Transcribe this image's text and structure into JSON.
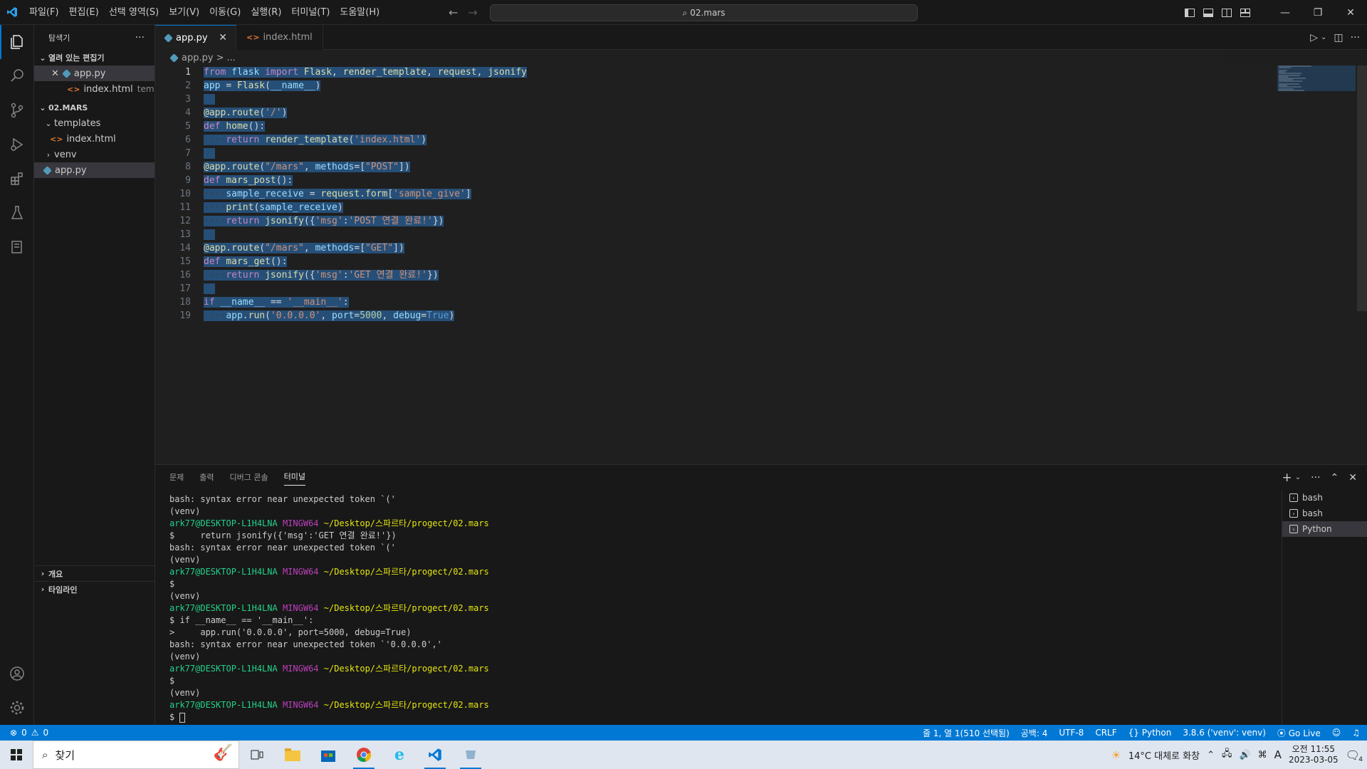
{
  "menu": [
    "파일(F)",
    "편집(E)",
    "선택 영역(S)",
    "보기(V)",
    "이동(G)",
    "실행(R)",
    "터미널(T)",
    "도움말(H)"
  ],
  "command_center": "02.mars",
  "sidebar": {
    "title": "탐색기",
    "more": "···",
    "open_editors": "열려 있는 편집기",
    "open_files": [
      {
        "name": "app.py",
        "desc": ""
      },
      {
        "name": "index.html",
        "desc": "templ..."
      }
    ],
    "project": "02.MARS",
    "tree": [
      {
        "name": "templates",
        "kind": "folder-open"
      },
      {
        "name": "index.html",
        "kind": "html"
      },
      {
        "name": "venv",
        "kind": "folder"
      },
      {
        "name": "app.py",
        "kind": "py"
      }
    ],
    "outline": "개요",
    "timeline": "타임라인"
  },
  "tabs": [
    {
      "label": "app.py",
      "active": true
    },
    {
      "label": "index.html",
      "active": false
    }
  ],
  "breadcrumb": {
    "file": "app.py",
    "sep": ">",
    "rest": "..."
  },
  "code_lines": [
    "from flask import Flask, render_template, request, jsonify",
    "app = Flask(__name__)",
    "",
    "@app.route('/')",
    "def home():",
    "····return render_template('index.html')",
    "",
    "@app.route(\"/mars\", methods=[\"POST\"])",
    "def mars_post():",
    "····sample_receive = request.form['sample_give']",
    "····print(sample_receive)",
    "····return jsonify({'msg':'POST 연결 완료!'})",
    "",
    "@app.route(\"/mars\", methods=[\"GET\"])",
    "def mars_get():",
    "····return jsonify({'msg':'GET 연결 완료!'})",
    "",
    "if __name__ == '__main__':",
    "····app.run('0.0.0.0', port=5000, debug=True)"
  ],
  "panel": {
    "tabs": [
      "문제",
      "출력",
      "디버그 콘솔",
      "터미널"
    ],
    "active_tab": "터미널",
    "terminals": [
      "bash",
      "bash",
      "Python"
    ],
    "lines": [
      {
        "t": "bash: syntax error near unexpected token `('"
      },
      {
        "t": "(venv)"
      },
      {
        "user": "ark77@DESKTOP-L1H4LNA",
        "host": "MINGW64",
        "path": "~/Desktop/스파르타/progect/02.mars"
      },
      {
        "t": "$     return jsonify({'msg':'GET 연결 완료!'})"
      },
      {
        "t": "bash: syntax error near unexpected token `('"
      },
      {
        "t": "(venv)"
      },
      {
        "user": "ark77@DESKTOP-L1H4LNA",
        "host": "MINGW64",
        "path": "~/Desktop/스파르타/progect/02.mars"
      },
      {
        "t": "$"
      },
      {
        "t": "(venv)"
      },
      {
        "user": "ark77@DESKTOP-L1H4LNA",
        "host": "MINGW64",
        "path": "~/Desktop/스파르타/progect/02.mars"
      },
      {
        "t": "$ if __name__ == '__main__':"
      },
      {
        "t": ">     app.run('0.0.0.0', port=5000, debug=True)"
      },
      {
        "t": "bash: syntax error near unexpected token `'0.0.0.0','"
      },
      {
        "t": "(venv)"
      },
      {
        "user": "ark77@DESKTOP-L1H4LNA",
        "host": "MINGW64",
        "path": "~/Desktop/스파르타/progect/02.mars"
      },
      {
        "t": "$"
      },
      {
        "t": "(venv)"
      },
      {
        "user": "ark77@DESKTOP-L1H4LNA",
        "host": "MINGW64",
        "path": "~/Desktop/스파르타/progect/02.mars"
      }
    ],
    "prompt": "$ "
  },
  "status": {
    "errors": "0",
    "warnings": "0",
    "position": "줄 1, 열 1(510 선택됨)",
    "spaces": "공백: 4",
    "encoding": "UTF-8",
    "eol": "CRLF",
    "language": "Python",
    "interpreter": "3.8.6 ('venv': venv)",
    "golive": "Go Live"
  },
  "taskbar": {
    "search": "찾기",
    "weather": "14°C  대체로 화창",
    "ime": "A",
    "time": "오전 11:55",
    "date": "2023-03-05",
    "notif_count": "4"
  },
  "colors": {
    "accent": "#0078d4",
    "selection": "#264f78",
    "editor_bg": "#1f1f1f",
    "chrome_bg": "#181818"
  }
}
